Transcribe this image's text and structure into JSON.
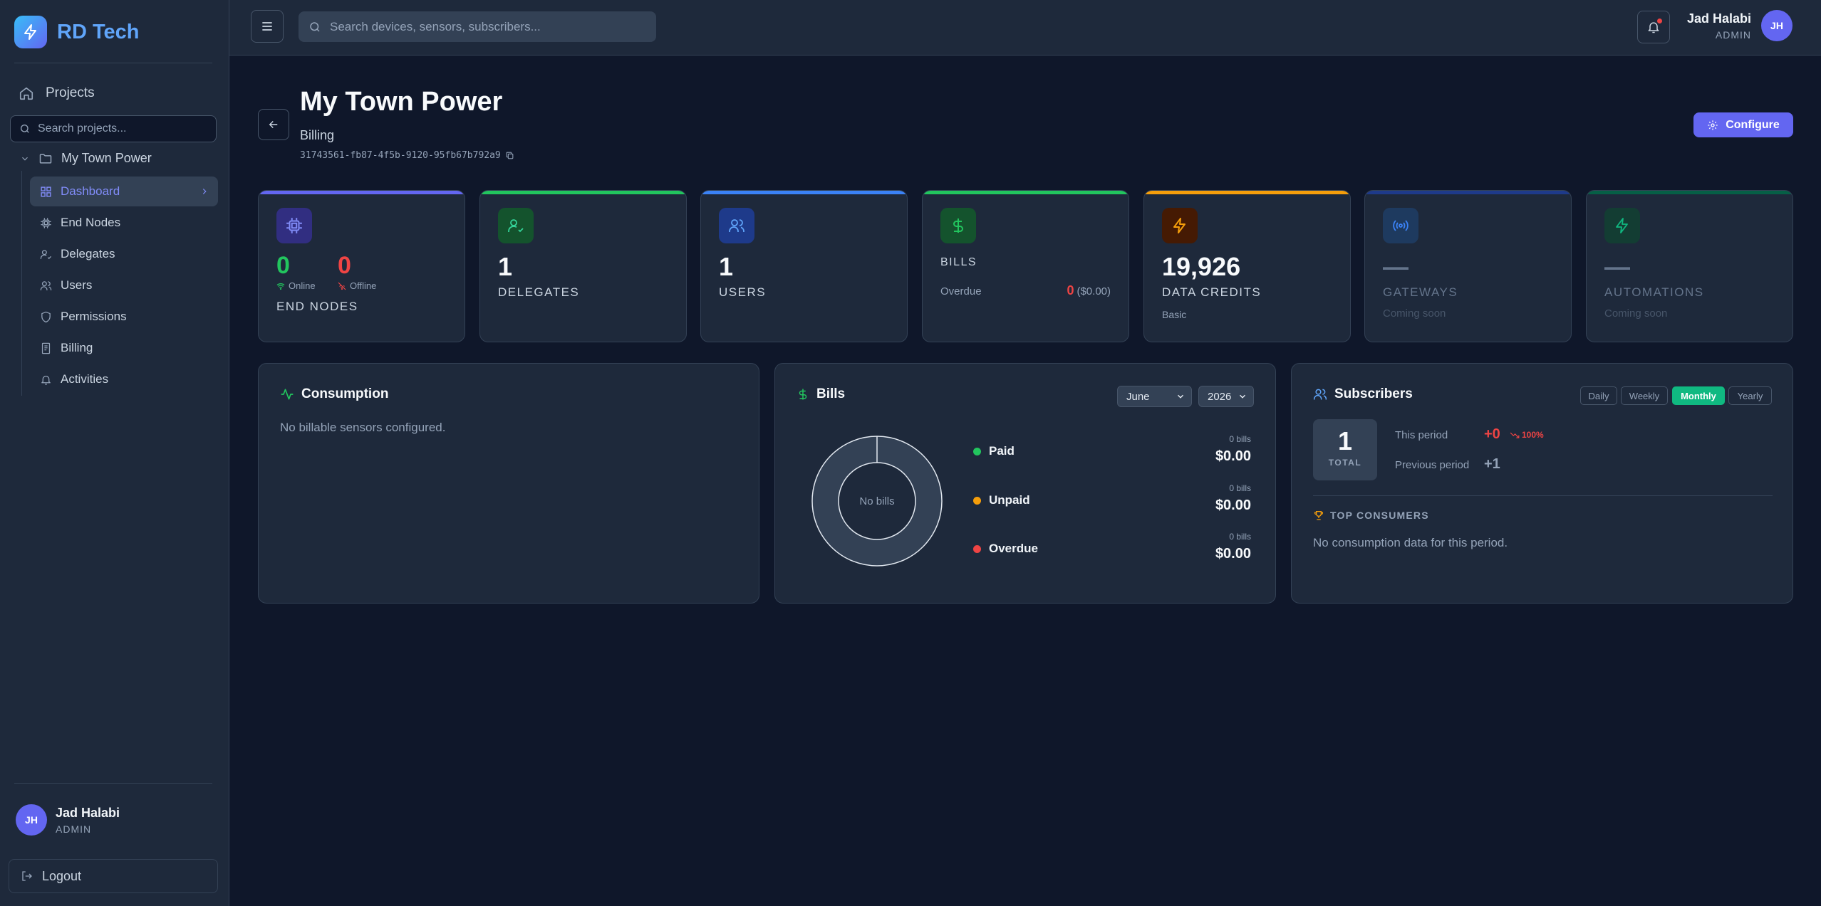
{
  "brand": {
    "name": "RD Tech"
  },
  "sidebar": {
    "projects_label": "Projects",
    "search_placeholder": "Search projects...",
    "project_name": "My Town Power",
    "items": [
      {
        "label": "Dashboard",
        "icon": "dashboard-icon",
        "active": true
      },
      {
        "label": "End Nodes",
        "icon": "chip-icon"
      },
      {
        "label": "Delegates",
        "icon": "user-check-icon"
      },
      {
        "label": "Users",
        "icon": "users-icon"
      },
      {
        "label": "Permissions",
        "icon": "shield-icon"
      },
      {
        "label": "Billing",
        "icon": "receipt-icon"
      },
      {
        "label": "Activities",
        "icon": "bell-icon"
      }
    ],
    "user": {
      "initials": "JH",
      "name": "Jad Halabi",
      "role": "ADMIN"
    },
    "logout_label": "Logout"
  },
  "topbar": {
    "search_placeholder": "Search devices, sensors, subscribers...",
    "user": {
      "initials": "JH",
      "name": "Jad Halabi",
      "role": "ADMIN"
    }
  },
  "header": {
    "title": "My Town Power",
    "subtitle": "Billing",
    "id": "31743561-fb87-4f5b-9120-95fb67b792a9",
    "configure_label": "Configure"
  },
  "stats": {
    "end_nodes": {
      "online": "0",
      "online_label": "Online",
      "offline": "0",
      "offline_label": "Offline",
      "label": "END NODES"
    },
    "delegates": {
      "value": "1",
      "label": "DELEGATES"
    },
    "users": {
      "value": "1",
      "label": "USERS"
    },
    "bills": {
      "label": "BILLS",
      "overdue_label": "Overdue",
      "overdue_count": "0",
      "overdue_amount": "($0.00)"
    },
    "data_credits": {
      "value": "19,926",
      "label": "DATA CREDITS",
      "note": "Basic"
    },
    "gateways": {
      "value": "—",
      "label": "GATEWAYS",
      "note": "Coming soon"
    },
    "automations": {
      "value": "—",
      "label": "AUTOMATIONS",
      "note": "Coming soon"
    }
  },
  "consumption": {
    "title": "Consumption",
    "empty": "No billable sensors configured."
  },
  "bills": {
    "title": "Bills",
    "month": "June",
    "year": "2026",
    "donut_center": "No bills",
    "legend": [
      {
        "name": "Paid",
        "count": "0 bills",
        "amount": "$0.00",
        "color": "#22c55e"
      },
      {
        "name": "Unpaid",
        "count": "0 bills",
        "amount": "$0.00",
        "color": "#f59e0b"
      },
      {
        "name": "Overdue",
        "count": "0 bills",
        "amount": "$0.00",
        "color": "#ef4444"
      }
    ]
  },
  "subscribers": {
    "title": "Subscribers",
    "periods": [
      "Daily",
      "Weekly",
      "Monthly",
      "Yearly"
    ],
    "active_period": "Monthly",
    "total": "1",
    "total_label": "TOTAL",
    "this_period_label": "This period",
    "this_period_value": "+0",
    "change": "100%",
    "previous_period_label": "Previous period",
    "previous_period_value": "+1",
    "top_consumers_label": "TOP CONSUMERS",
    "empty": "No consumption data for this period."
  },
  "colors": {
    "accent": "#6366f1",
    "online": "#22c55e",
    "offline": "#ef4444",
    "active_period": "#10b981"
  }
}
